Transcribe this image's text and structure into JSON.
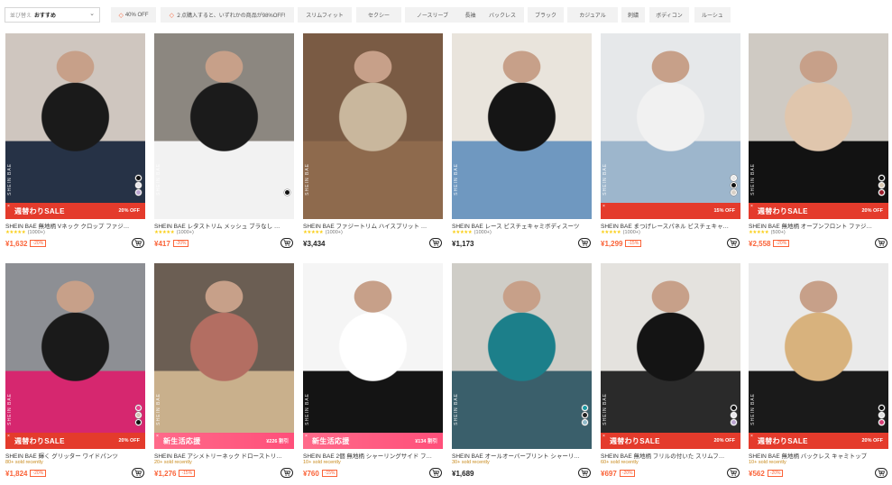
{
  "sort": {
    "label": "並び替え",
    "value": "おすすめ"
  },
  "chips": [
    {
      "label": "40% OFF",
      "tag": true
    },
    {
      "label": "２点購入すると、いずれかの商品が98%OFF!",
      "tag": true
    },
    {
      "label": "スリムフィット",
      "tag": false
    },
    {
      "label": "セクシー",
      "tag": false
    },
    {
      "label": "ノースリーブ",
      "tag": false
    },
    {
      "label": "長袖",
      "tag": false
    },
    {
      "label": "バックレス",
      "tag": false
    },
    {
      "label": "ブラック",
      "tag": false
    },
    {
      "label": "カジュアル",
      "tag": false
    },
    {
      "label": "刺繍",
      "tag": false
    },
    {
      "label": "ボディコン",
      "tag": false
    },
    {
      "label": "ルーシュ",
      "tag": false
    }
  ],
  "products": [
    {
      "name": "SHEIN BAE 無地柄 Vネック クロップ ファジ…",
      "meta": "★★★★★ (1000+)",
      "price": "¥1,632",
      "discount": "-20%",
      "banner": {
        "style": "red",
        "title": "週替わりSALE",
        "off": "20% OFF"
      },
      "swatches": [
        "#111111",
        "#e8e6ea",
        "#b9a3cf"
      ],
      "photo": [
        "#cfc6bf",
        "#1a1a1a",
        "#263246"
      ]
    },
    {
      "name": "SHEIN BAE レタストリム メッシュ ブラなし …",
      "meta": "★★★★★ (1000+)",
      "price": "¥417",
      "discount": "-20%",
      "banner": null,
      "swatches": [
        "#111111"
      ],
      "photo": [
        "#8c8780",
        "#1b1b1b",
        "#f2f2f2"
      ]
    },
    {
      "name": "SHEIN BAE ファジートリム ハイスプリット …",
      "meta": "★★★★★ (1000+)",
      "price": "¥3,434",
      "discount": "",
      "banner": null,
      "swatches": [],
      "photo": [
        "#7a5b44",
        "#c9b79d",
        "#8e6a4d"
      ]
    },
    {
      "name": "SHEIN BAE レース ビスチェキャミボディスーツ",
      "meta": "★★★★★ (1000+)",
      "price": "¥1,173",
      "discount": "",
      "banner": null,
      "swatches": [],
      "photo": [
        "#e9e4dc",
        "#151515",
        "#6f98c0"
      ]
    },
    {
      "name": "SHEIN BAE まつげレースパネル ビスチェキャ…",
      "meta": "★★★★★ (1000+)",
      "price": "¥1,299",
      "discount": "-15%",
      "banner": {
        "style": "red",
        "title": "",
        "off": "15% OFF"
      },
      "swatches": [
        "#e8e8e8",
        "#111111",
        "#d7cfc5"
      ],
      "photo": [
        "#e6e8ea",
        "#f1f1f1",
        "#9db6cc"
      ]
    },
    {
      "name": "SHEIN BAE 無地柄 オープンフロント ファジ…",
      "meta": "★★★★★ (500+)",
      "price": "¥2,558",
      "discount": "-20%",
      "banner": {
        "style": "red",
        "title": "週替わりSALE",
        "off": "20% OFF"
      },
      "swatches": [
        "#111111",
        "#d9c8b2",
        "#9b1c2a"
      ],
      "photo": [
        "#cfcac3",
        "#e0c6ad",
        "#121212"
      ]
    },
    {
      "name": "SHEIN BAE 輝く グリッター ワイドパンツ",
      "meta": "80+ sold recently",
      "price": "¥1,824",
      "discount": "-20%",
      "banner": {
        "style": "red",
        "title": "週替わりSALE",
        "off": "20% OFF"
      },
      "swatches": [
        "#e83e8c",
        "#d4c7b8",
        "#111111"
      ],
      "photo": [
        "#8d8f94",
        "#1a1a1a",
        "#d6276f"
      ]
    },
    {
      "name": "SHEIN BAE アシメトリーネック ドローストリ…",
      "meta": "20+ sold recently",
      "price": "¥1,276",
      "discount": "-15%",
      "banner": {
        "style": "pink",
        "title": "新生活応援",
        "off": "¥226 割引"
      },
      "swatches": [],
      "photo": [
        "#6b5e53",
        "#b36e62",
        "#c9b08c"
      ]
    },
    {
      "name": "SHEIN BAE 2個 無地柄 シャーリングサイド フ…",
      "meta": "10+ sold recently",
      "price": "¥760",
      "discount": "-15%",
      "banner": {
        "style": "pink",
        "title": "新生活応援",
        "off": "¥134 割引"
      },
      "swatches": [],
      "photo": [
        "#f5f5f5",
        "#ffffff",
        "#141414"
      ]
    },
    {
      "name": "SHEIN BAE オールオーバープリント シャーリ…",
      "meta": "30+ sold recently",
      "price": "¥1,689",
      "discount": "",
      "banner": null,
      "swatches": [
        "#1e9aa4",
        "#222222",
        "#8fb9c8"
      ],
      "photo": [
        "#cfcdc7",
        "#1c7f8a",
        "#3a5f6b"
      ]
    },
    {
      "name": "SHEIN BAE 無地柄 フリルの付いた スリムフ…",
      "meta": "60+ sold recently",
      "price": "¥697",
      "discount": "-20%",
      "banner": {
        "style": "red",
        "title": "週替わりSALE",
        "off": "20% OFF"
      },
      "swatches": [
        "#111111",
        "#e8e6ea",
        "#b9a3cf"
      ],
      "photo": [
        "#e4e2de",
        "#141414",
        "#2a2a2a"
      ]
    },
    {
      "name": "SHEIN BAE 無地柄 バックレス キャミトップ",
      "meta": "10+ sold recently",
      "price": "¥562",
      "discount": "-20%",
      "banner": {
        "style": "red",
        "title": "週替わりSALE",
        "off": "20% OFF"
      },
      "swatches": [
        "#111111",
        "#e0e0e0",
        "#d63c74"
      ],
      "photo": [
        "#eaeaea",
        "#d8b27d",
        "#1a1a1a"
      ]
    }
  ],
  "brand_watermark": "SHEIN BAE",
  "colors": {
    "sale": "#fa6338",
    "banner_red": "#e43b2c",
    "banner_pink": "#ff5a80",
    "sold": "#c88a1c",
    "star": "#facf19"
  },
  "icons": {
    "cart": "add-to-cart-icon",
    "chip_tag": "tag-icon",
    "sort": "chevron-down-icon"
  }
}
